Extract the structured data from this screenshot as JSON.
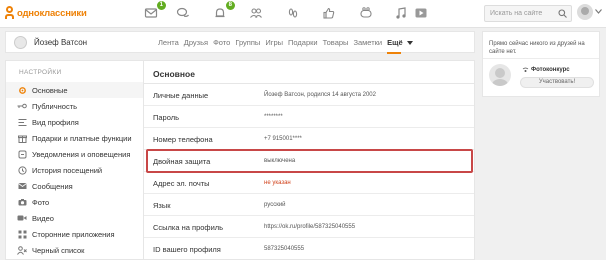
{
  "header": {
    "logo_text": "одноклассники",
    "messages_badge": "1",
    "notifications_badge": "8",
    "search_placeholder": "Искать на сайте"
  },
  "profile": {
    "name": "Йозеф Ватсон",
    "tabs": [
      "Лента",
      "Друзья",
      "Фото",
      "Группы",
      "Игры",
      "Подарки",
      "Товары",
      "Заметки"
    ],
    "more_label": "Ещё"
  },
  "sidebar": {
    "heading": "НАСТРОЙКИ",
    "items": [
      {
        "label": "Основные",
        "icon": "gear-icon"
      },
      {
        "label": "Публичность",
        "icon": "key-icon"
      },
      {
        "label": "Вид профиля",
        "icon": "profile-layout-icon"
      },
      {
        "label": "Подарки и платные функции",
        "icon": "gift-icon"
      },
      {
        "label": "Уведомления и оповещения",
        "icon": "bell-icon"
      },
      {
        "label": "История посещений",
        "icon": "history-icon"
      },
      {
        "label": "Сообщения",
        "icon": "envelope-icon"
      },
      {
        "label": "Фото",
        "icon": "camera-icon"
      },
      {
        "label": "Видео",
        "icon": "video-icon"
      },
      {
        "label": "Сторонние приложения",
        "icon": "apps-icon"
      },
      {
        "label": "Черный список",
        "icon": "blocked-user-icon"
      }
    ]
  },
  "main": {
    "title": "Основное",
    "rows": [
      {
        "label": "Личные данные",
        "value": "Йозеф Ватсон, родился 14 августа 2002"
      },
      {
        "label": "Пароль",
        "value": "********"
      },
      {
        "label": "Номер телефона",
        "value": "+7 915001****"
      },
      {
        "label": "Двойная защита",
        "value": "выключена"
      },
      {
        "label": "Адрес эл. почты",
        "value": "не указан"
      },
      {
        "label": "Язык",
        "value": "русский"
      },
      {
        "label": "Ссылка на профиль",
        "value": "https://ok.ru/profile/587325040555"
      },
      {
        "label": "ID вашего профиля",
        "value": "587325040555"
      }
    ]
  },
  "right_card": {
    "text": "Прямо сейчас никого из друзей на сайте нет.",
    "contest_label": "Фотоконкурс",
    "participate_button": "Участвовать!"
  },
  "colors": {
    "brand": "#ee8208",
    "badge": "#62ad21",
    "highlight": "#c84747",
    "warning_value": "#d0421b"
  }
}
